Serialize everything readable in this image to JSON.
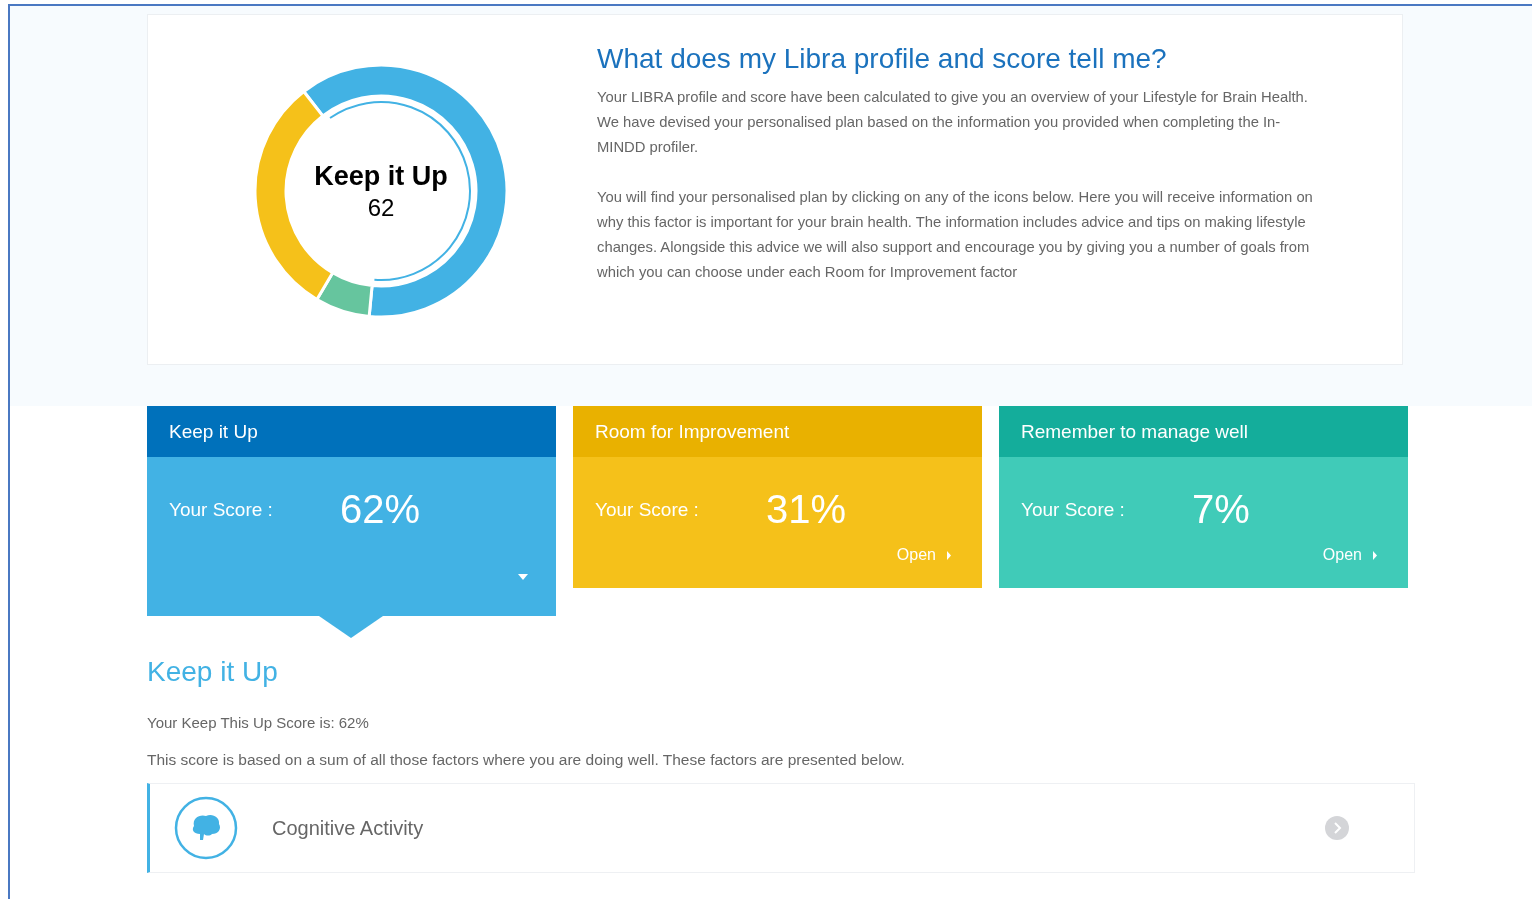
{
  "summary": {
    "title": "What does my Libra profile and score tell me?",
    "paragraphs": [
      "Your LIBRA profile and score have been calculated to give you an overview of your Lifestyle for Brain Health. We have devised your personalised plan based on the information you provided when completing the In-MINDD profiler.",
      "You will find your personalised plan by clicking on any of the icons below. Here you will receive information on why this factor is important for your brain health. The information includes advice and tips on making lifestyle changes. Alongside this advice we will also support and encourage you by giving you a number of goals from which you can choose under each Room for Improvement factor"
    ],
    "center_label": "Keep it Up",
    "center_value": "62"
  },
  "cards": [
    {
      "title": "Keep it Up",
      "score_label": "Your Score :",
      "score": "62%",
      "selected": true,
      "color": "#42b2e4",
      "kind": "keep"
    },
    {
      "title": "Room for Improvement",
      "score_label": "Your Score :",
      "score": "31%",
      "selected": false,
      "open_label": "Open",
      "color": "#f5c11a",
      "kind": "improve"
    },
    {
      "title": "Remember to manage well",
      "score_label": "Your Score :",
      "score": "7%",
      "selected": false,
      "open_label": "Open",
      "color": "#40cbb8",
      "kind": "manage"
    }
  ],
  "detail": {
    "heading": "Keep it Up",
    "score_line": "Your Keep This Up Score is: 62%",
    "description": "This score is based on a sum of all those factors where you are doing well. These factors are presented below.",
    "factors": [
      {
        "name": "Cognitive Activity"
      }
    ]
  }
}
